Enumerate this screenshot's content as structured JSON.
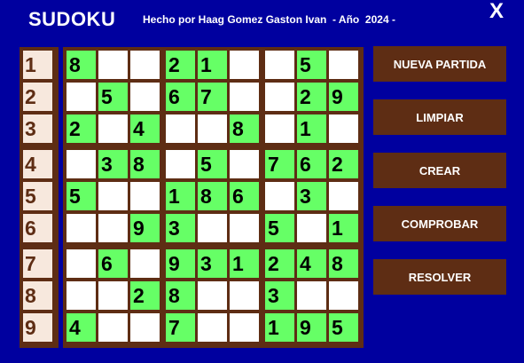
{
  "app": {
    "title": "SUDOKU",
    "credits": "Hecho por Haag Gomez Gaston Ivan  - Año  2024 -",
    "close_label": "X"
  },
  "colors": {
    "background": "#00009f",
    "frame": "#5e2d14",
    "filled_cell": "#66ff66",
    "empty_cell": "#ffffff",
    "row_number_bg": "#f7e8dd"
  },
  "row_numbers": [
    "1",
    "2",
    "3",
    "4",
    "5",
    "6",
    "7",
    "8",
    "9"
  ],
  "grid": [
    [
      "8",
      "",
      "",
      "2",
      "1",
      "",
      "",
      "5",
      ""
    ],
    [
      "",
      "5",
      "",
      "6",
      "7",
      "",
      "",
      "2",
      "9"
    ],
    [
      "2",
      "",
      "4",
      "",
      "",
      "8",
      "",
      "1",
      ""
    ],
    [
      "",
      "3",
      "8",
      "",
      "5",
      "",
      "7",
      "6",
      "2"
    ],
    [
      "5",
      "",
      "",
      "1",
      "8",
      "6",
      "",
      "3",
      ""
    ],
    [
      "",
      "",
      "9",
      "3",
      "",
      "",
      "5",
      "",
      "1"
    ],
    [
      "",
      "6",
      "",
      "9",
      "3",
      "1",
      "2",
      "4",
      "8"
    ],
    [
      "",
      "",
      "2",
      "8",
      "",
      "",
      "3",
      "",
      ""
    ],
    [
      "4",
      "",
      "",
      "7",
      "",
      "",
      "1",
      "9",
      "5"
    ]
  ],
  "buttons": {
    "new_game": "NUEVA PARTIDA",
    "clear": "LIMPIAR",
    "create": "CREAR",
    "check": "COMPROBAR",
    "solve": "RESOLVER"
  }
}
